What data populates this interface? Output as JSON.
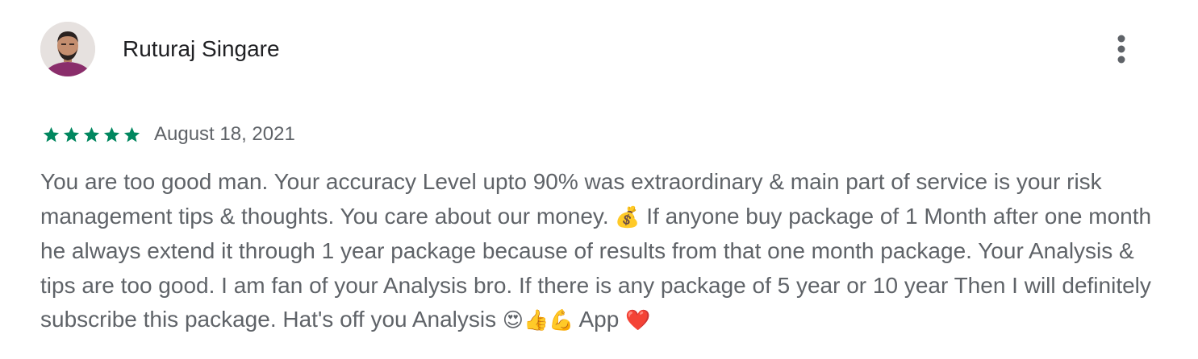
{
  "review": {
    "author": "Ruturaj Singare",
    "rating": 5,
    "rating_max": 5,
    "date": "August 18, 2021",
    "text_parts": {
      "p1": "You are too good man. Your accuracy Level upto 90% was extraordinary & main part of service is your risk management tips & thoughts. You care about our money. ",
      "e1": "💰",
      "p2": " If anyone buy package of 1 Month after one month he always extend it through 1 year package because of results from that one month package. Your Analysis & tips are too good. I am fan of your Analysis bro. If there is any package of 5 year or 10 year Then I will definitely subscribe this package. Hat's off you Analysis ",
      "e2": "😍👍💪",
      "p3": " App ",
      "e3": "❤️"
    }
  },
  "icons": {
    "avatar": "user-photo",
    "more": "more-vertical-icon",
    "star": "star-icon"
  },
  "colors": {
    "star": "#01875f",
    "name": "#202124",
    "secondary_text": "#5f6368",
    "more_icon": "#5f6368"
  }
}
